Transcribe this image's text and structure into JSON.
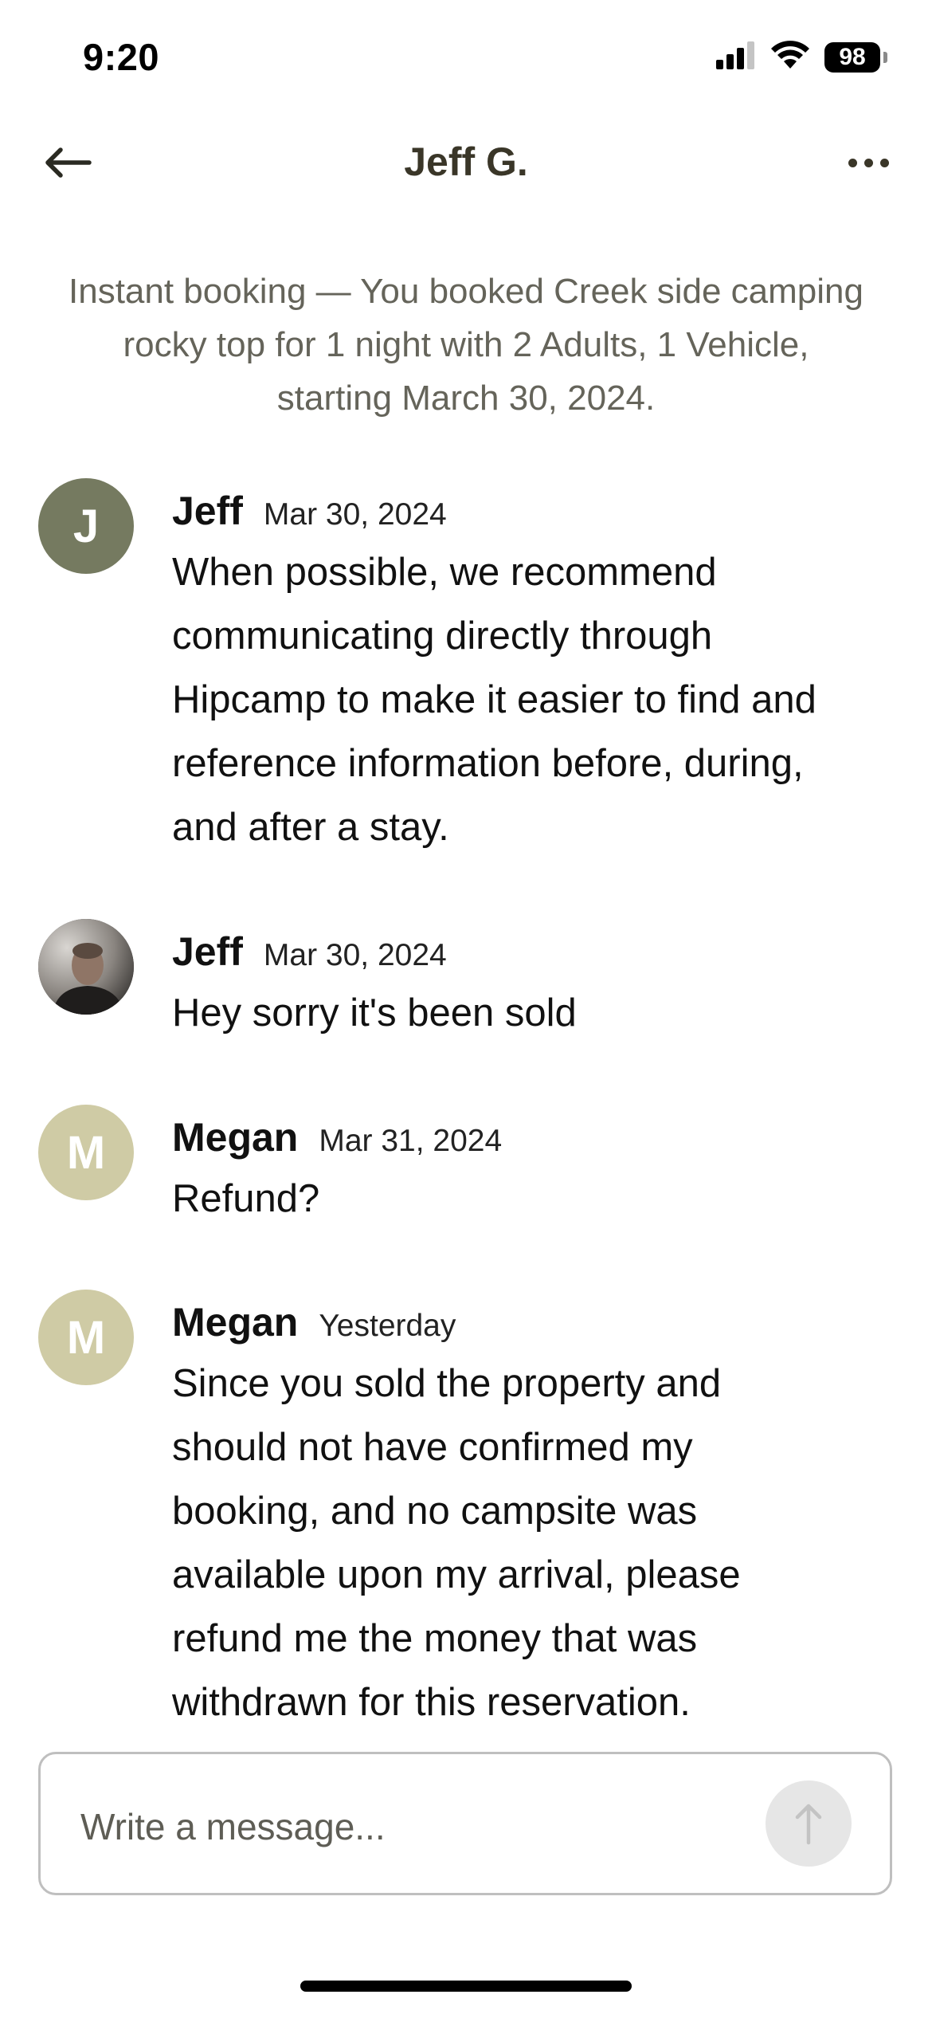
{
  "status_bar": {
    "time": "9:20",
    "battery": "98",
    "icons": [
      "cellular-signal-icon",
      "wifi-icon",
      "battery-icon"
    ]
  },
  "header": {
    "title": "Jeff G.",
    "back_icon": "arrow-left-icon",
    "more_icon": "more-horizontal-icon"
  },
  "booking_notice": {
    "line1": "Instant booking — You booked Creek side camping",
    "line2": "rocky top  for 1 night with 2 Adults, 1 Vehicle,",
    "line3": "starting March 30, 2024."
  },
  "messages": [
    {
      "sender": "Jeff",
      "date": "Mar 30, 2024",
      "avatar_initial": "J",
      "avatar_color": "#757a60",
      "lines": [
        "When possible, we recommend",
        "communicating directly through",
        "Hipcamp to make it easier to find and",
        "reference information before, during,",
        "and after a stay."
      ]
    },
    {
      "sender": "Jeff",
      "date": "Mar 30, 2024",
      "avatar_initial": "",
      "avatar_type": "photo",
      "lines": [
        "Hey sorry it's been sold"
      ]
    },
    {
      "sender": "Megan",
      "date": "Mar 31, 2024",
      "avatar_initial": "M",
      "avatar_color": "#cfcba5",
      "lines": [
        "Refund?"
      ]
    },
    {
      "sender": "Megan",
      "date": "Yesterday",
      "avatar_initial": "M",
      "avatar_color": "#cfcba5",
      "lines": [
        "Since you sold the property and",
        "should not have confirmed my",
        "booking, and no campsite was",
        "available upon my arrival, please",
        "refund me the money that was",
        "withdrawn for this reservation."
      ]
    }
  ],
  "composer": {
    "placeholder": "Write a message...",
    "send_icon": "arrow-up-icon"
  }
}
